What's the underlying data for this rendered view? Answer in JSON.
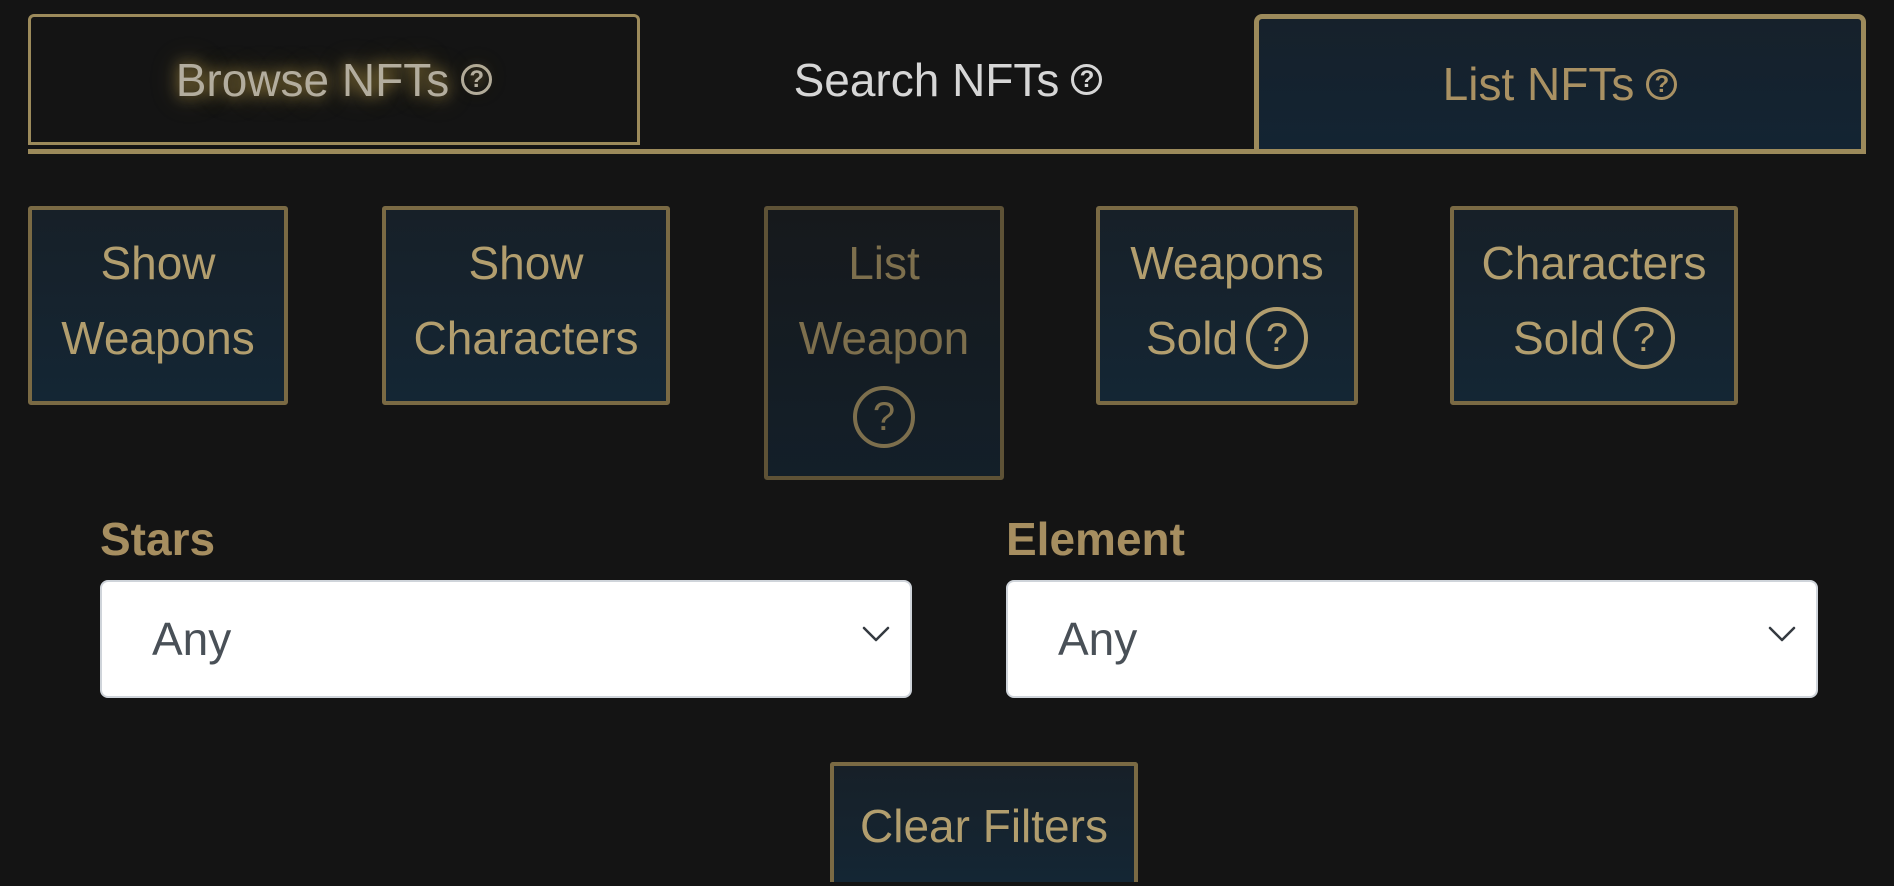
{
  "tabs": {
    "browse": {
      "label": "Browse NFTs",
      "help": "?"
    },
    "search": {
      "label": "Search NFTs",
      "help": "?"
    },
    "list": {
      "label": "List NFTs",
      "help": "?"
    }
  },
  "actions": {
    "show_weapons": {
      "line1": "Show",
      "line2": "Weapons"
    },
    "show_characters": {
      "line1": "Show",
      "line2": "Characters"
    },
    "list_weapon": {
      "line1": "List",
      "line2": "Weapon",
      "help": "?",
      "disabled": true
    },
    "weapons_sold": {
      "line1": "Weapons",
      "line2": "Sold",
      "help": "?"
    },
    "characters_sold": {
      "line1": "Characters",
      "line2": "Sold",
      "help": "?"
    }
  },
  "filters": {
    "stars": {
      "label": "Stars",
      "value": "Any"
    },
    "element": {
      "label": "Element",
      "value": "Any"
    }
  },
  "clear_filters_label": "Clear Filters",
  "colors": {
    "background": "#141414",
    "gold": "#9c8a5b",
    "gold_text": "#a68e60",
    "button_bg": "#142634",
    "select_text": "#495057"
  }
}
